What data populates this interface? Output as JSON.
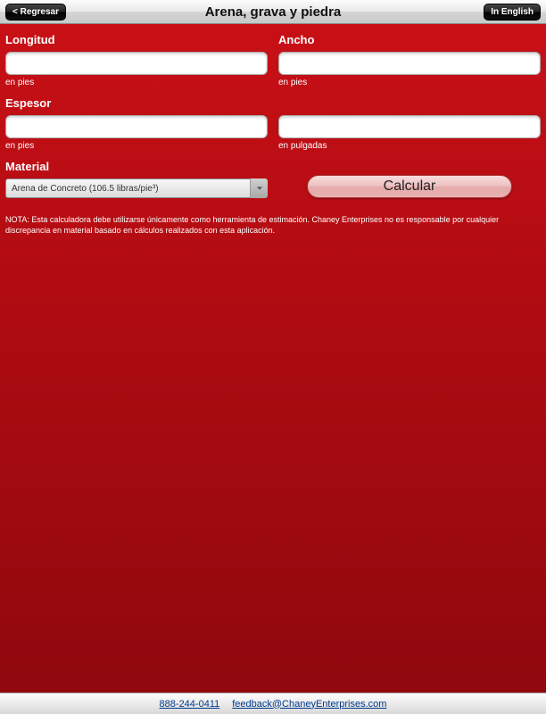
{
  "header": {
    "back_label": "< Regresar",
    "title": "Arena, grava y piedra",
    "lang_label": "In English"
  },
  "fields": {
    "longitud": {
      "label": "Longitud",
      "value": "",
      "hint": "en pies"
    },
    "ancho": {
      "label": "Ancho",
      "value": "",
      "hint": "en pies"
    },
    "espesor": {
      "label": "Espesor",
      "value": "",
      "hint": "en pies"
    },
    "extra": {
      "label": "",
      "value": "",
      "hint": "en pulgadas"
    }
  },
  "material": {
    "label": "Material",
    "selected": "Arena de Concreto (106.5 libras/pie³)"
  },
  "calculate_label": "Calcular",
  "note": "NOTA: Esta calculadora debe utilizarse únicamente como herramienta de estimación. Chaney Enterprises no es responsable por cualquier discrepancia en material basado en cálculos realizados con esta aplicación.",
  "footer": {
    "phone": "888-244-0411",
    "email": "feedback@ChaneyEnterprises.com"
  }
}
